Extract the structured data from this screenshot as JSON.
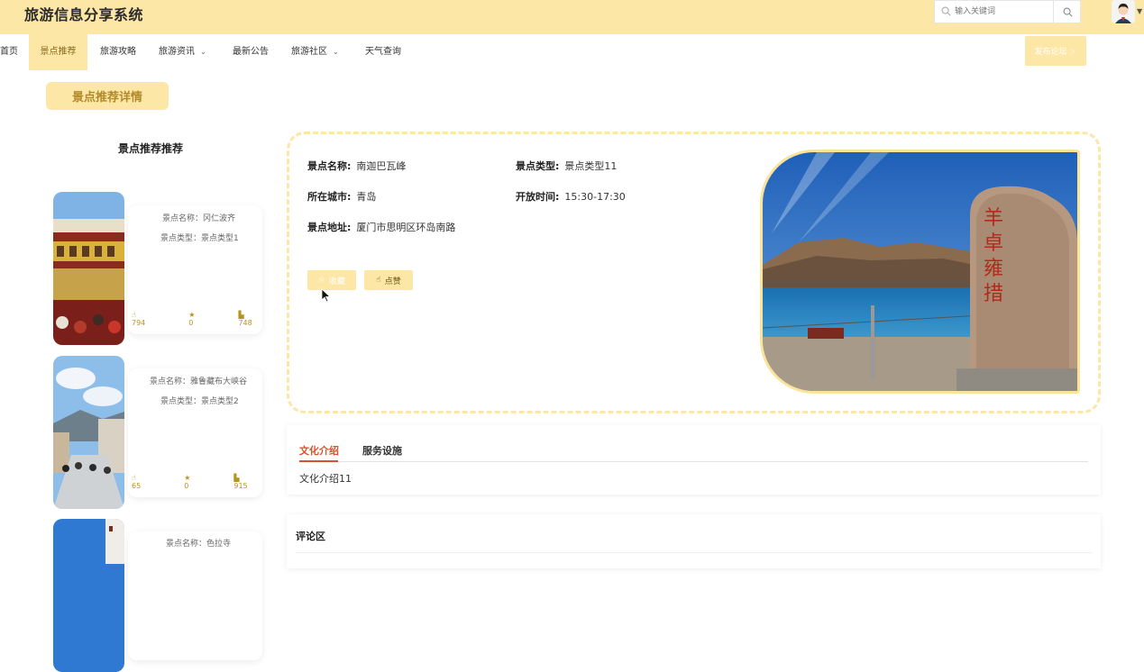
{
  "header": {
    "site_title": "旅游信息分享系统",
    "search_placeholder": "输入关键词"
  },
  "nav": {
    "items": [
      {
        "label": "首页"
      },
      {
        "label": "景点推荐"
      },
      {
        "label": "旅游攻略"
      },
      {
        "label": "旅游资讯"
      },
      {
        "label": "最新公告"
      },
      {
        "label": "旅游社区"
      },
      {
        "label": "天气查询"
      }
    ],
    "post_button": "发布论坛 ☞"
  },
  "page": {
    "heading": "景点推荐详情"
  },
  "sidebar": {
    "title": "景点推荐推荐",
    "cards": [
      {
        "name": "景点名称：冈仁波齐",
        "type": "景点类型：景点类型1",
        "likes": "794",
        "favs": "0",
        "views": "748"
      },
      {
        "name": "景点名称：雅鲁藏布大峡谷",
        "type": "景点类型：景点类型2",
        "likes": "65",
        "favs": "0",
        "views": "915"
      },
      {
        "name": "景点名称：色拉寺"
      }
    ]
  },
  "detail": {
    "name_label": "景点名称:",
    "name_value": "南迦巴瓦峰",
    "type_label": "景点类型:",
    "type_value": "景点类型11",
    "city_label": "所在城市:",
    "city_value": "青岛",
    "hours_label": "开放时间:",
    "hours_value": "15:30-17:30",
    "address_label": "景点地址:",
    "address_value": "厦门市思明区环岛南路",
    "fav_button": "收藏",
    "like_button": "点赞"
  },
  "tabs": {
    "items": [
      {
        "label": "文化介绍"
      },
      {
        "label": "服务设施"
      }
    ],
    "content": "文化介绍11"
  },
  "comments": {
    "title": "评论区"
  },
  "colors": {
    "accent": "#fde7a6",
    "tab_active": "#d4532c",
    "stat": "#b8941f"
  }
}
